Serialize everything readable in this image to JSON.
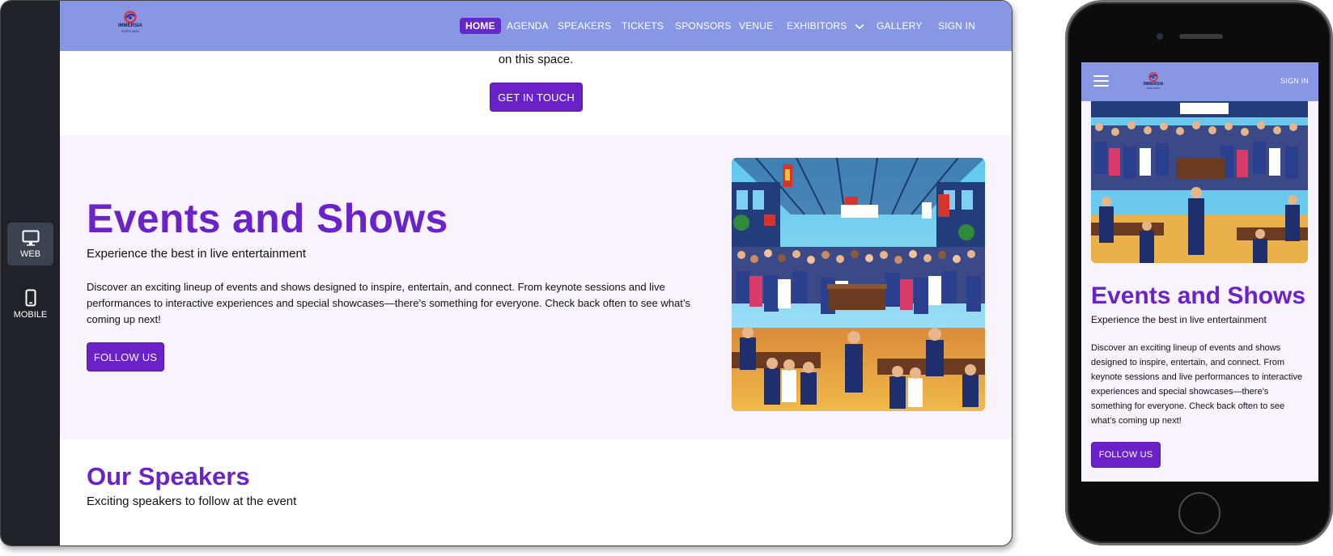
{
  "brand": {
    "name": "IMMERSIA",
    "sub": "EXPO 2025"
  },
  "view_switcher": {
    "web_label": "WEB",
    "mobile_label": "MOBILE"
  },
  "nav": {
    "items": [
      "HOME",
      "AGENDA",
      "SPEAKERS",
      "TICKETS",
      "SPONSORS",
      "VENUE",
      "EXHIBITORS",
      "GALLERY"
    ],
    "active": "HOME",
    "sign_in": "SIGN IN"
  },
  "intro": {
    "partial_text": "on this space.",
    "cta_label": "GET IN TOUCH"
  },
  "events": {
    "title": "Events and Shows",
    "subtitle": "Experience the best in live entertainment",
    "description": "Discover an exciting lineup of events and shows designed to inspire, entertain, and connect. From keynote sessions and live performances to interactive experiences and special showcases—there’s something for everyone. Check back often to see what’s coming up next!",
    "cta_label": "FOLLOW US"
  },
  "speakers": {
    "title": "Our Speakers",
    "subtitle": "Exciting speakers to follow at the event"
  },
  "colors": {
    "nav_bg": "#8797e4",
    "accent": "#6a22c9",
    "section_bg": "#f8f3fd",
    "sidebar_bg": "#1f2228"
  }
}
